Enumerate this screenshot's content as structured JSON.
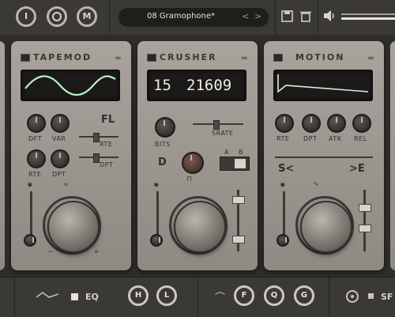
{
  "topbar": {
    "mode_buttons": [
      {
        "label": "I",
        "icon": "io-icon"
      },
      {
        "label": "",
        "icon": "ring-icon"
      },
      {
        "label": "M",
        "icon": "m-icon"
      }
    ],
    "preset_name": "08 Gramophone*",
    "prev_label": "<",
    "next_label": ">",
    "save_icon": "save-icon",
    "delete_icon": "trash-icon",
    "volume_icon": "speaker-icon"
  },
  "modules": {
    "tapemod": {
      "title": "TAPEMOD",
      "menu": "=",
      "knob_labels": [
        "DFT",
        "VAR",
        "RTE",
        "DPT"
      ],
      "fl_label": "FL",
      "rte_label": "RTE",
      "dpt_label": "DPT"
    },
    "crusher": {
      "title": "CRUSHER",
      "menu": "=",
      "bits_value": "15",
      "srate_value": "21609",
      "bits_label": "BITS",
      "srate_label": "SRATE",
      "mode_letter": "D",
      "ab_a": "A",
      "ab_b": "B",
      "minus": "−",
      "plus": "+"
    },
    "motion": {
      "title": "MOTION",
      "menu": "=",
      "knob_labels": [
        "RTE",
        "DPT",
        "ATK",
        "REL"
      ],
      "left_label": "S<",
      "right_label": ">E"
    }
  },
  "bottombar": {
    "eq_label": "EQ",
    "knobs": [
      "H",
      "L",
      "F",
      "Q",
      "G"
    ],
    "right_label": "SF"
  },
  "colors": {
    "panel": "#a8a49d",
    "screen": "#1b1a18",
    "wave": "#b9f2c2",
    "bar": "#3b3936"
  }
}
